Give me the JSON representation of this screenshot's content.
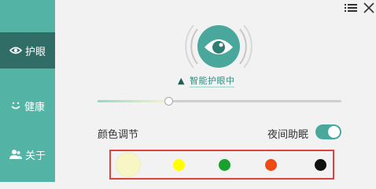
{
  "sidebar": {
    "items": [
      {
        "label": "护眼",
        "icon": "eye-icon",
        "active": true
      },
      {
        "label": "健康",
        "icon": "smile-icon",
        "active": false
      },
      {
        "label": "关于",
        "icon": "users-icon",
        "active": false
      }
    ]
  },
  "topbar": {
    "menu_icon": "menu-icon",
    "close_icon": "close-icon"
  },
  "main": {
    "status_text": "智能护眼中",
    "status_prefix": "▲",
    "slider_value": 0.29,
    "color_label": "颜色调节",
    "night_label": "夜间助眠",
    "night_mode_on": true,
    "swatches": [
      {
        "color": "#f8f6c4",
        "selected": true
      },
      {
        "color": "#ffff00",
        "selected": false
      },
      {
        "color": "#1aa02e",
        "selected": false
      },
      {
        "color": "#f04a14",
        "selected": false
      },
      {
        "color": "#111111",
        "selected": false
      }
    ]
  },
  "colors": {
    "sidebar": "#53b3a5",
    "sidebar_active": "#2f6d66",
    "accent": "#4aa79b",
    "highlight_border": "#e0433d"
  }
}
